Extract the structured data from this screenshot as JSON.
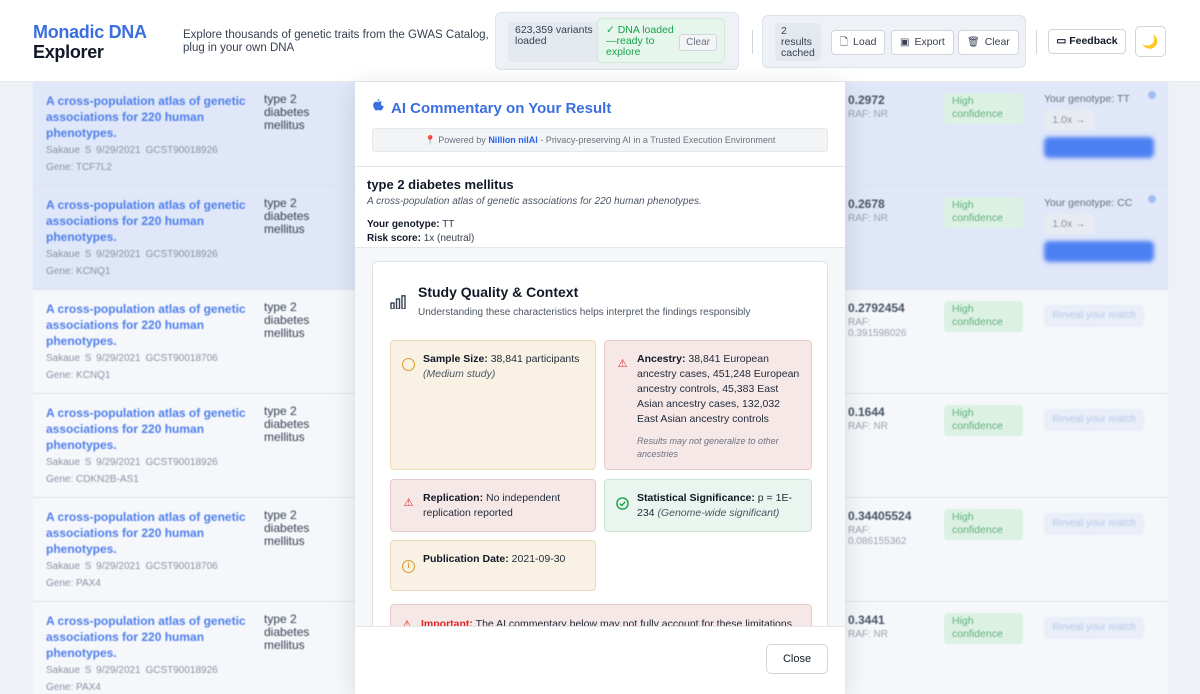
{
  "header": {
    "brand_line1": "Monadic DNA",
    "brand_line2": "Explorer",
    "tagline": "Explore thousands of genetic traits from the GWAS Catalog, plug in your own DNA",
    "variants_loaded": "623,359 variants loaded",
    "dna_status": "✓ DNA loaded —ready to explore",
    "clear_small": "Clear",
    "results_cached": "2 results cached",
    "load": "Load",
    "export": "Export",
    "clear": "Clear",
    "feedback": "Feedback",
    "theme_icon": "🌙"
  },
  "table": {
    "rows": [
      {
        "study": "A cross-population atlas of genetic associations for 220 human phenotypes.",
        "author": "Sakaue S",
        "date": "9/29/2021",
        "accession": "GCST90018926",
        "gene": "Gene: TCF7L2",
        "trait": "type 2 diabetes mellitus",
        "pvalue": "0.2972",
        "raf": "RAF: NR",
        "confidence": "High confidence",
        "genotype": "Your genotype:  TT",
        "multiplier": "1.0x →",
        "reveal": ""
      },
      {
        "study": "A cross-population atlas of genetic associations for 220 human phenotypes.",
        "author": "Sakaue S",
        "date": "9/29/2021",
        "accession": "GCST90018926",
        "gene": "Gene: KCNQ1",
        "trait": "type 2 diabetes mellitus",
        "pvalue": "0.2678",
        "raf": "RAF: NR",
        "confidence": "High confidence",
        "genotype": "Your genotype:  CC",
        "multiplier": "1.0x →",
        "reveal": ""
      },
      {
        "study": "A cross-population atlas of genetic associations for 220 human phenotypes.",
        "author": "Sakaue S",
        "date": "9/29/2021",
        "accession": "GCST90018706",
        "gene": "Gene: KCNQ1",
        "trait": "type 2 diabetes mellitus",
        "pvalue": "0.2792454",
        "raf": "RAF: 0.391598026",
        "confidence": "High confidence",
        "genotype": "",
        "multiplier": "",
        "reveal": "Reveal your match"
      },
      {
        "study": "A cross-population atlas of genetic associations for 220 human phenotypes.",
        "author": "Sakaue S",
        "date": "9/29/2021",
        "accession": "GCST90018926",
        "gene": "Gene: CDKN2B-AS1",
        "trait": "type 2 diabetes mellitus",
        "pvalue": "0.1644",
        "raf": "RAF: NR",
        "confidence": "High confidence",
        "genotype": "",
        "multiplier": "",
        "reveal": "Reveal your match"
      },
      {
        "study": "A cross-population atlas of genetic associations for 220 human phenotypes.",
        "author": "Sakaue S",
        "date": "9/29/2021",
        "accession": "GCST90018706",
        "gene": "Gene: PAX4",
        "trait": "type 2 diabetes mellitus",
        "pvalue": "0.34405524",
        "raf": "RAF: 0.086155362",
        "confidence": "High confidence",
        "genotype": "",
        "multiplier": "",
        "reveal": "Reveal your match"
      },
      {
        "study": "A cross-population atlas of genetic associations for 220 human phenotypes.",
        "author": "Sakaue S",
        "date": "9/29/2021",
        "accession": "GCST90018926",
        "gene": "Gene: PAX4",
        "trait": "type 2 diabetes mellitus",
        "pvalue": "0.3441",
        "raf": "RAF: NR",
        "confidence": "High confidence",
        "genotype": "",
        "multiplier": "",
        "reveal": "Reveal your match"
      }
    ]
  },
  "modal": {
    "title": "AI Commentary on Your Result",
    "powered_prefix": "Powered by ",
    "powered_brand": "Nillion nilAI",
    "powered_suffix": " - Privacy-preserving AI in a Trusted Execution Environment",
    "trait": "type 2 diabetes mellitus",
    "study": "A cross-population atlas of genetic associations for 220 human phenotypes.",
    "genotype_label": "Your genotype:",
    "genotype_value": " TT",
    "risk_label": "Risk score:",
    "risk_value": " 1x (neutral)",
    "quality": {
      "title": "Study Quality & Context",
      "subtitle": "Understanding these characteristics helps interpret the findings responsibly",
      "sample_label": "Sample Size:",
      "sample_value": " 38,841 participants ",
      "sample_note": "(Medium study)",
      "ancestry_label": "Ancestry:",
      "ancestry_value": " 38,841 European ancestry cases, 451,248 European ancestry controls, 45,383 East Asian ancestry cases, 132,032 East Asian ancestry controls",
      "ancestry_note": "Results may not generalize to other ancestries",
      "replication_label": "Replication:",
      "replication_value": " No independent replication reported",
      "significance_label": "Statistical Significance:",
      "significance_value": " p = 1E-234 ",
      "significance_note": "(Genome-wide significant)",
      "pubdate_label": "Publication Date:",
      "pubdate_value": " 2021-09-30",
      "important_label": "Important:",
      "important_text": " The AI commentary below may not fully account for these limitations."
    },
    "close": "Close"
  }
}
